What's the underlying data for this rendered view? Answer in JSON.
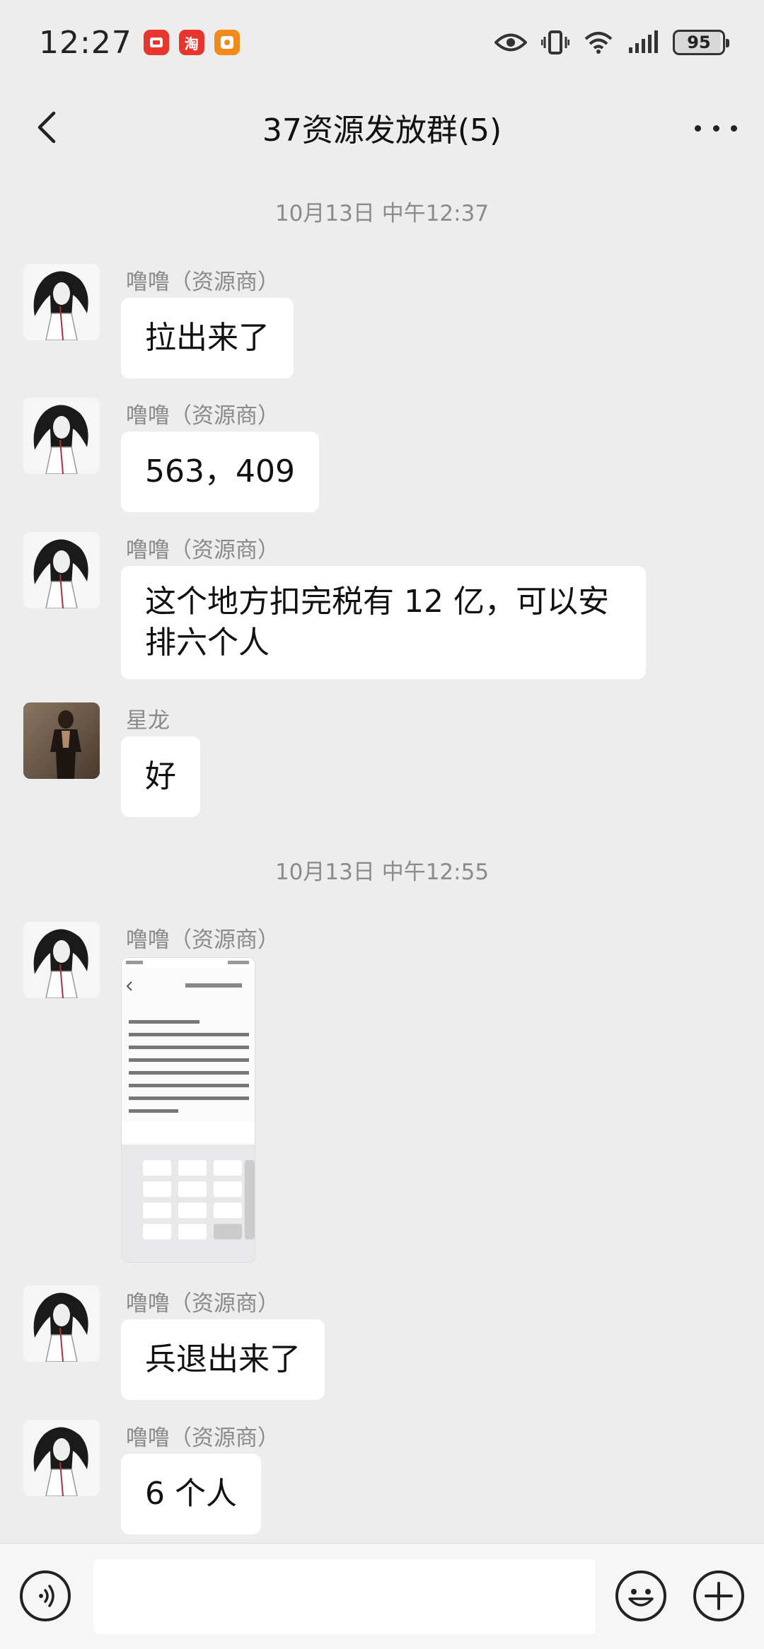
{
  "status_bar": {
    "time": "12:27",
    "battery": "95",
    "notifications": [
      "red-notification-icon",
      "taobao-icon",
      "orange-notification-icon"
    ],
    "taobao_text": "淘"
  },
  "nav": {
    "title": "37资源发放群(5)"
  },
  "timestamps": [
    "10月13日 中午12:37",
    "10月13日 中午12:55"
  ],
  "messages": [
    {
      "sender": "噜噜（资源商）",
      "text": "拉出来了"
    },
    {
      "sender": "噜噜（资源商）",
      "text": "563，409"
    },
    {
      "sender": "噜噜（资源商）",
      "text": "这个地方扣完税有 12 亿，可以安排六个人",
      "line1": "这个地方扣完税有 12 亿，可以安",
      "line2": "排六个人"
    },
    {
      "sender": "星龙",
      "text": "好"
    },
    {
      "sender": "噜噜（资源商）",
      "type": "image"
    },
    {
      "sender": "噜噜（资源商）",
      "text": "兵退出来了"
    },
    {
      "sender": "噜噜（资源商）",
      "text": "6 个人"
    }
  ],
  "colors": {
    "background": "#ededed",
    "bubble": "#ffffff",
    "secondary_text": "#8b8b8b"
  }
}
